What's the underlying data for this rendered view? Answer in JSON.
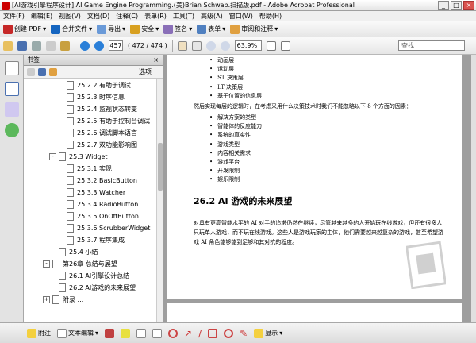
{
  "window": {
    "title": "[AI游戏引擎程序设计].AI Game Engine Programming.(美)Brian Schwab.扫描版.pdf - Adobe Acrobat Professional"
  },
  "menu": [
    "文件(F)",
    "编辑(E)",
    "视图(V)",
    "文档(D)",
    "注释(C)",
    "表单(R)",
    "工具(T)",
    "高级(A)",
    "窗口(W)",
    "帮助(H)"
  ],
  "toolbar1": {
    "create_pdf": "创建 PDF",
    "combine": "合并文件",
    "export": "导出",
    "secure": "安全",
    "sign": "签名",
    "forms": "表单",
    "review": "审阅和注释"
  },
  "toolbar2": {
    "page_current": "457",
    "page_of": "( 472 / 474 )",
    "zoom": "63.9%",
    "search_placeholder": "查找"
  },
  "panel": {
    "title": "书签",
    "options": "选项",
    "close": "×"
  },
  "bookmarks": [
    {
      "label": "25.2.2 有助于调试",
      "level": 3
    },
    {
      "label": "25.2.3 时序信息",
      "level": 3
    },
    {
      "label": "25.2.4 监视状态转变",
      "level": 3
    },
    {
      "label": "25.2.5 有助于控制台调试",
      "level": 3
    },
    {
      "label": "25.2.6 调试脚本语言",
      "level": 3
    },
    {
      "label": "25.2.7 双功能影响图",
      "level": 3
    },
    {
      "label": "25.3 Widget",
      "level": 2,
      "expand": "-"
    },
    {
      "label": "25.3.1 实现",
      "level": 3
    },
    {
      "label": "25.3.2 BasicButton",
      "level": 3
    },
    {
      "label": "25.3.3 Watcher",
      "level": 3
    },
    {
      "label": "25.3.4 RadioButton",
      "level": 3
    },
    {
      "label": "25.3.5 OnOffButton",
      "level": 3
    },
    {
      "label": "25.3.6 ScrubberWidget",
      "level": 3
    },
    {
      "label": "25.3.7 程序集成",
      "level": 3
    },
    {
      "label": "25.4 小结",
      "level": 2
    },
    {
      "label": "第26章   总结与展望",
      "level": 1,
      "expand": "-"
    },
    {
      "label": "26.1 AI引擎设计总结",
      "level": 2
    },
    {
      "label": "26.2 AI游戏的未来展望",
      "level": 2
    },
    {
      "label": "附录  ...",
      "level": 1,
      "expand": "+"
    }
  ],
  "document": {
    "top_items": [
      "动画层",
      "运动层",
      "ST 决策层",
      "LT 决策层",
      "基于位置的信息层"
    ],
    "intro": "然后实现每层的逻辑时，在考虑采用什么决策技术时我们不能忽略以下 8 个方面的因素：",
    "factors": [
      "解决方案的类型",
      "智能体的反应能力",
      "系统的真实性",
      "游戏类型",
      "内容相关需求",
      "游戏平台",
      "开发限制",
      "娱乐限制"
    ],
    "heading": "26.2   AI 游戏的未来展望",
    "body": "对具有更高智能水平的 AI 对手的追求仍然在继续，尽管越来越多的人开始玩在线游戏，但还有很多人只玩单人游戏，而不玩在线游戏。这些人是游戏玩家的主体，他们需要越来越复杂的游戏，甚至希望游戏 AI 角色能够能到足够和其对抗的程度。"
  },
  "bottombar": {
    "note": "附注",
    "text_edit": "文本编辑",
    "show": "显示"
  }
}
